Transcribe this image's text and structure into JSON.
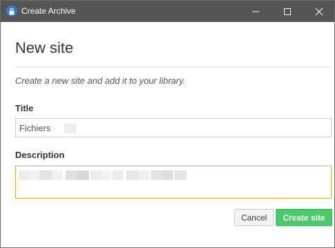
{
  "window": {
    "title": "Create Archive"
  },
  "dialog": {
    "heading": "New site",
    "subtitle": "Create a new site and add it to your library."
  },
  "form": {
    "title_label": "Title",
    "title_value": "Fichiers",
    "description_label": "Description",
    "description_value": ""
  },
  "buttons": {
    "cancel_label": "Cancel",
    "create_label": "Create site"
  },
  "icons": {
    "app": "lock-icon",
    "minimize": "minimize-icon",
    "maximize": "maximize-icon",
    "close": "close-icon"
  },
  "colors": {
    "titlebar": "#555555",
    "app_icon": "#2f7bd6",
    "focus_border": "#e8a83c",
    "create_button": "#4cc96a"
  }
}
